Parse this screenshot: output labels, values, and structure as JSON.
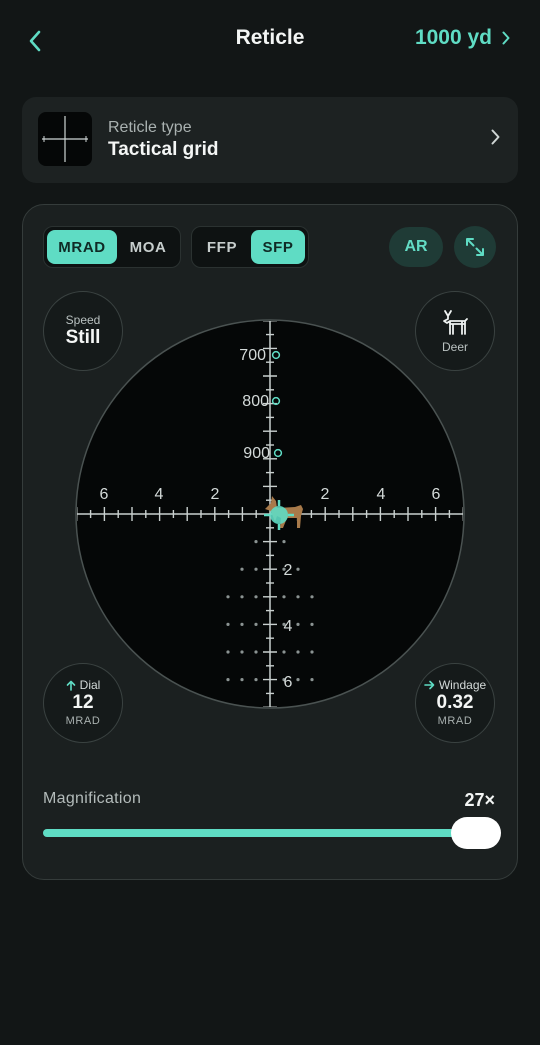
{
  "header": {
    "title": "Reticle",
    "range": "1000 yd",
    "back_icon": "chevron-left-icon",
    "range_icon": "chevron-right-icon"
  },
  "reticle_type": {
    "label": "Reticle type",
    "value": "Tactical grid"
  },
  "units": {
    "options": [
      "MRAD",
      "MOA"
    ],
    "selected": "MRAD"
  },
  "focal_plane": {
    "options": [
      "FFP",
      "SFP"
    ],
    "selected": "SFP"
  },
  "ar_label": "AR",
  "speed": {
    "label": "Speed",
    "value": "Still"
  },
  "target": {
    "label": "Deer",
    "icon": "deer-icon"
  },
  "dial": {
    "label": "Dial",
    "value": "12",
    "unit": "MRAD",
    "icon": "arrow-up-icon"
  },
  "windage": {
    "label": "Windage",
    "value": "0.32",
    "unit": "MRAD",
    "icon": "arrow-right-icon"
  },
  "scope": {
    "range_marks": [
      "700",
      "800",
      "900"
    ],
    "horizontal_labels": [
      "6",
      "4",
      "2",
      "2",
      "4",
      "6"
    ],
    "vertical_labels": [
      "2",
      "4",
      "6"
    ]
  },
  "magnification": {
    "label": "Magnification",
    "value": "27×",
    "level_fraction": 1.0
  },
  "colors": {
    "accent": "#5fdcc4",
    "background": "#121616",
    "card": "#1d2222",
    "scope_bg": "#050707"
  }
}
